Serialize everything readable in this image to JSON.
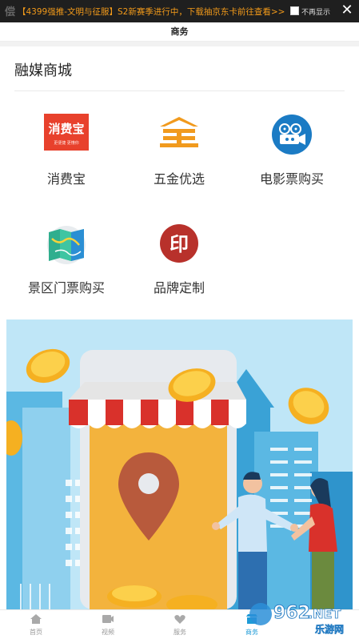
{
  "ad": {
    "text": "【4399强推-文明与征服】S2新赛季进行中，下载抽京东卡前往查看>>",
    "hide_label": "不再显示",
    "close_glyph": "✕"
  },
  "header": {
    "title": "商务"
  },
  "section": {
    "title": "融媒商城"
  },
  "shop_items": [
    {
      "label": "消费宝",
      "icon": "xiaofeibao-logo",
      "logo_main": "消费宝",
      "logo_sub": "更便捷  更懂你"
    },
    {
      "label": "五金优选",
      "icon": "wujin-logo"
    },
    {
      "label": "电影票购买",
      "icon": "film-projector-icon"
    },
    {
      "label": "景区门票购买",
      "icon": "map-icon"
    },
    {
      "label": "品牌定制",
      "icon": "brand-seal-icon",
      "seal_char": "印"
    }
  ],
  "nav": [
    {
      "label": "首页",
      "icon": "home-icon"
    },
    {
      "label": "视频",
      "icon": "video-icon"
    },
    {
      "label": "服务",
      "icon": "heart-icon"
    },
    {
      "label": "商务",
      "icon": "shop-icon",
      "active": true
    }
  ],
  "watermark": {
    "num": "962",
    "dot_net": ".NET",
    "cn": "乐游网"
  },
  "colors": {
    "ad_text": "#f29a1a",
    "accent_blue": "#1e9bd7",
    "xiaofeibao_red": "#e8412c",
    "wujin_orange": "#f19a1d",
    "seal_red": "#b8312b"
  }
}
